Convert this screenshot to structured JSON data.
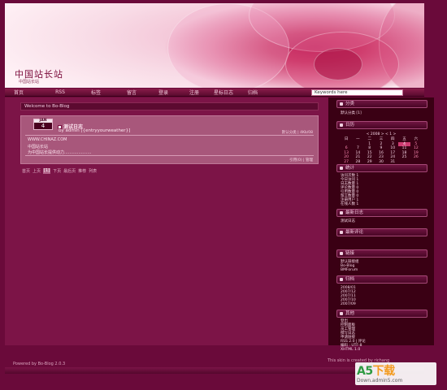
{
  "header": {
    "title": "中国站长站",
    "subtitle": "中国站长站"
  },
  "nav": {
    "items": [
      {
        "label": "首页"
      },
      {
        "label": "RSS"
      },
      {
        "label": "标签"
      },
      {
        "label": "留言"
      },
      {
        "label": "登录"
      },
      {
        "label": "注册"
      },
      {
        "label": "星标日志"
      },
      {
        "label": "归档"
      }
    ],
    "search_placeholder": "Keywords here"
  },
  "main": {
    "welcome": "Welcome to Bo-Blog",
    "post": {
      "month": "JAN",
      "day": "4",
      "title": "测试日志",
      "author": "by admin [{entryyourweather}]",
      "meta": "默认分类 | 4Kb/08",
      "body": [
        "WWW.CHINAZ.COM",
        "中国站长站",
        "为中国站长提供动力....................."
      ],
      "footer": "引用(0) | 管理"
    },
    "pager": [
      "首页",
      "上页",
      "[1]",
      "下页",
      "最后页",
      "推荐",
      "列表"
    ],
    "pager_active": 2
  },
  "sidebar": {
    "categories": {
      "title": "分类",
      "items": [
        "默认分类 [1]"
      ]
    },
    "calendar": {
      "title": "日历",
      "nav": "< 2008 > < 1 >",
      "weekdays": [
        "日",
        "一",
        "二",
        "三",
        "四",
        "五",
        "六"
      ],
      "weeks": [
        [
          "",
          "",
          "1",
          "2",
          "3",
          "4",
          "5"
        ],
        [
          "6",
          "7",
          "8",
          "9",
          "10",
          "11",
          "12"
        ],
        [
          "13",
          "14",
          "15",
          "16",
          "17",
          "18",
          "19"
        ],
        [
          "20",
          "21",
          "22",
          "23",
          "24",
          "25",
          "26"
        ],
        [
          "27",
          "28",
          "29",
          "30",
          "31",
          "",
          ""
        ]
      ],
      "today": "4"
    },
    "stats": {
      "title": "统计",
      "items": [
        "访问次数 1",
        "今日访问 1",
        "日志数量 1",
        "评论数量 0",
        "引用数量 0",
        "留言数量 0",
        "注册用户 1",
        "在线人数 1"
      ]
    },
    "recent_entries": {
      "title": "最新日志",
      "items": [
        "测试日志"
      ]
    },
    "recent_comments": {
      "title": "最新评论",
      "items": []
    },
    "links": {
      "title": "链接",
      "items": [
        "默认链接组",
        "Bo-Blog",
        "BMForum"
      ]
    },
    "archives": {
      "title": "归档",
      "items": [
        "2008/01",
        "2007/12",
        "2007/11",
        "2007/10",
        "2007/09"
      ]
    },
    "misc": {
      "title": "其他",
      "items": [
        "登出",
        "控制面板",
        "员工管理",
        "撰写日志",
        "申请链接",
        "RSS 2.0 | 评论",
        "编码 : UTF-8",
        "XHTML 1.0"
      ]
    }
  },
  "footer": {
    "left": "Powered by Bo-Blog 2.0.3",
    "right": "This skin is created by richang"
  },
  "watermark": {
    "brand_a5": "A5",
    "brand_text": "下载",
    "url": "Down.admin5.com"
  }
}
